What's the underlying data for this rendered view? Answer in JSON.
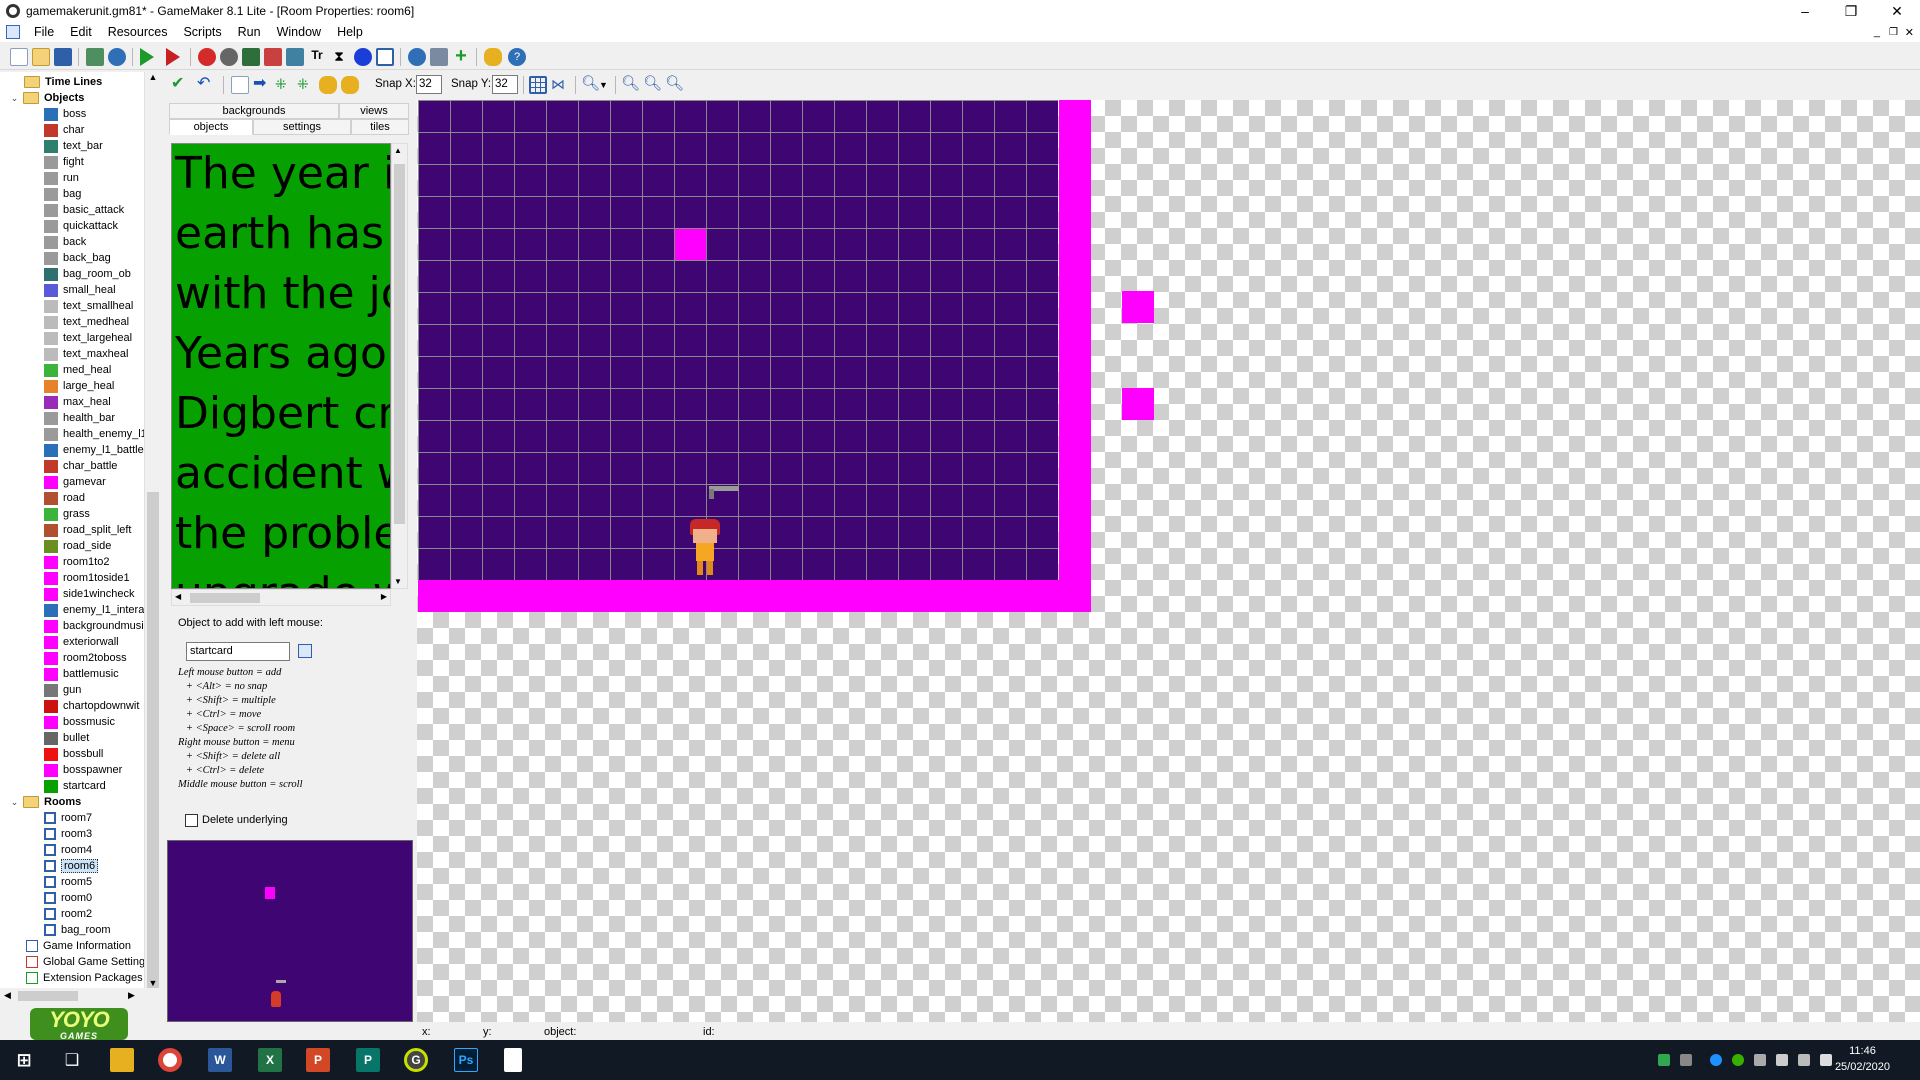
{
  "window": {
    "title": "gamemakerunit.gm81* - GameMaker 8.1 Lite - [Room Properties: room6]",
    "minimize": "–",
    "maximize": "❐",
    "close": "✕"
  },
  "menu": [
    "File",
    "Edit",
    "Resources",
    "Scripts",
    "Run",
    "Window",
    "Help"
  ],
  "room_toolbar": {
    "snap_x_label": "Snap X:",
    "snap_x": "32",
    "snap_y_label": "Snap Y:",
    "snap_y": "32"
  },
  "tree": {
    "timelines": "Time Lines",
    "objects_folder": "Objects",
    "objects": [
      {
        "name": "boss",
        "icon": "#2a6fb8"
      },
      {
        "name": "char",
        "icon": "#c0392b"
      },
      {
        "name": "text_bar",
        "icon": "#2f7f6f"
      },
      {
        "name": "fight",
        "icon": "#9a9a9a"
      },
      {
        "name": "run",
        "icon": "#9a9a9a"
      },
      {
        "name": "bag",
        "icon": "#9a9a9a"
      },
      {
        "name": "basic_attack",
        "icon": "#9a9a9a"
      },
      {
        "name": "quickattack",
        "icon": "#9a9a9a"
      },
      {
        "name": "back",
        "icon": "#9a9a9a"
      },
      {
        "name": "back_bag",
        "icon": "#9a9a9a"
      },
      {
        "name": "bag_room_ob",
        "icon": "#2f6f6f"
      },
      {
        "name": "small_heal",
        "icon": "#5a5ad8"
      },
      {
        "name": "text_smallheal",
        "icon": "#bbbbbb"
      },
      {
        "name": "text_medheal",
        "icon": "#bbbbbb"
      },
      {
        "name": "text_largeheal",
        "icon": "#bbbbbb"
      },
      {
        "name": "text_maxheal",
        "icon": "#bbbbbb"
      },
      {
        "name": "med_heal",
        "icon": "#3cb43c"
      },
      {
        "name": "large_heal",
        "icon": "#e8822a"
      },
      {
        "name": "max_heal",
        "icon": "#9a2ab8"
      },
      {
        "name": "health_bar",
        "icon": "#9a9a9a"
      },
      {
        "name": "health_enemy_l1",
        "icon": "#9a9a9a"
      },
      {
        "name": "enemy_l1_battle",
        "icon": "#2a6fb8"
      },
      {
        "name": "char_battle",
        "icon": "#c0392b"
      },
      {
        "name": "gamevar",
        "icon": "#ff00ff"
      },
      {
        "name": "road",
        "icon": "#b05030"
      },
      {
        "name": "grass",
        "icon": "#3cb43c"
      },
      {
        "name": "road_split_left",
        "icon": "#b05030"
      },
      {
        "name": "road_side",
        "icon": "#6b8e23"
      },
      {
        "name": "room1to2",
        "icon": "#ff00ff"
      },
      {
        "name": "room1toside1",
        "icon": "#ff00ff"
      },
      {
        "name": "side1wincheck",
        "icon": "#ff00ff"
      },
      {
        "name": "enemy_l1_intera",
        "icon": "#2a6fb8"
      },
      {
        "name": "backgroundmusi",
        "icon": "#ff00ff"
      },
      {
        "name": "exteriorwall",
        "icon": "#ff00ff"
      },
      {
        "name": "room2toboss",
        "icon": "#ff00ff"
      },
      {
        "name": "battlemusic",
        "icon": "#ff00ff"
      },
      {
        "name": "gun",
        "icon": "#777777"
      },
      {
        "name": "chartopdownwit",
        "icon": "#cc1111"
      },
      {
        "name": "bossmusic",
        "icon": "#ff00ff"
      },
      {
        "name": "bullet",
        "icon": "#666666"
      },
      {
        "name": "bossbull",
        "icon": "#ee1111"
      },
      {
        "name": "bosspawner",
        "icon": "#ff00ff"
      },
      {
        "name": "startcard",
        "icon": "#06a000"
      }
    ],
    "rooms_folder": "Rooms",
    "rooms": [
      "room7",
      "room3",
      "room4",
      "room6",
      "room5",
      "room0",
      "room2",
      "bag_room"
    ],
    "selected_room": "room6",
    "extras": [
      "Game Information",
      "Global Game Setting",
      "Extension Packages"
    ]
  },
  "tabs": {
    "backgrounds": "backgrounds",
    "views": "views",
    "objects": "objects",
    "settings": "settings",
    "tiles": "tiles"
  },
  "preview_lines": [
    "The year is",
    "earth has c",
    "with the jo",
    "Years ago,",
    "Digbert cre",
    "accident w",
    "the proble",
    "upgrade w"
  ],
  "object_panel": {
    "label": "Object to add with left mouse:",
    "object": "startcard",
    "help": [
      "Left mouse button = add",
      "   + <Alt> = no snap",
      "   + <Shift> = multiple",
      "   + <Ctrl> = move",
      "   + <Space> = scroll room",
      "Right mouse button = menu",
      "   + <Shift> = delete all",
      "   + <Ctrl> = delete",
      "Middle mouse button = scroll"
    ],
    "delete_underlying": "Delete underlying"
  },
  "status": {
    "x": "x:",
    "y": "y:",
    "object": "object:",
    "id": "id:"
  },
  "taskbar": {
    "time": "11:46",
    "date": "25/02/2020"
  },
  "colors": {
    "room_bg": "#3f0673",
    "wall": "#ff00ff",
    "startcard": "#06a000"
  }
}
